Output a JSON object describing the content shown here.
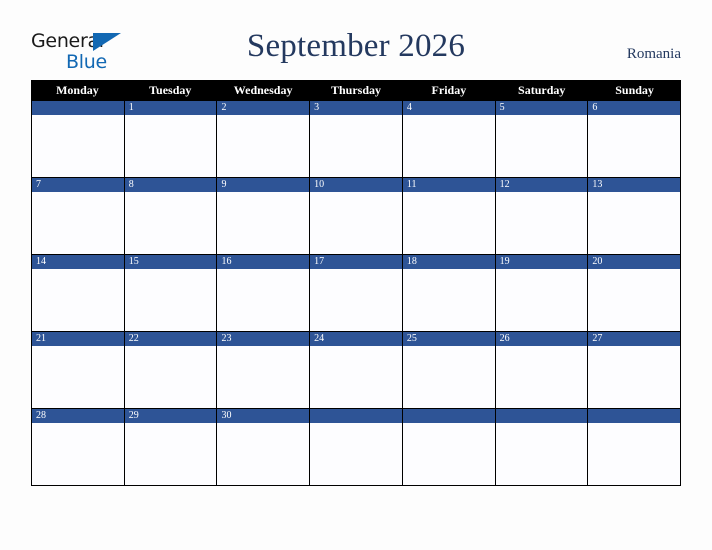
{
  "brand": {
    "name_part1": "General",
    "name_part2": "Blue",
    "triangle_color": "#1268b3"
  },
  "header": {
    "title": "September 2026",
    "country": "Romania",
    "title_color": "#24395f"
  },
  "calendar": {
    "weekdays": [
      "Monday",
      "Tuesday",
      "Wednesday",
      "Thursday",
      "Friday",
      "Saturday",
      "Sunday"
    ],
    "header_bg": "#000000",
    "day_bar_color": "#2e5496",
    "cell_bg": "#fdfdff",
    "border_color": "#000000",
    "weeks": [
      [
        "",
        "1",
        "2",
        "3",
        "4",
        "5",
        "6"
      ],
      [
        "7",
        "8",
        "9",
        "10",
        "11",
        "12",
        "13"
      ],
      [
        "14",
        "15",
        "16",
        "17",
        "18",
        "19",
        "20"
      ],
      [
        "21",
        "22",
        "23",
        "24",
        "25",
        "26",
        "27"
      ],
      [
        "28",
        "29",
        "30",
        "",
        "",
        "",
        ""
      ]
    ]
  }
}
